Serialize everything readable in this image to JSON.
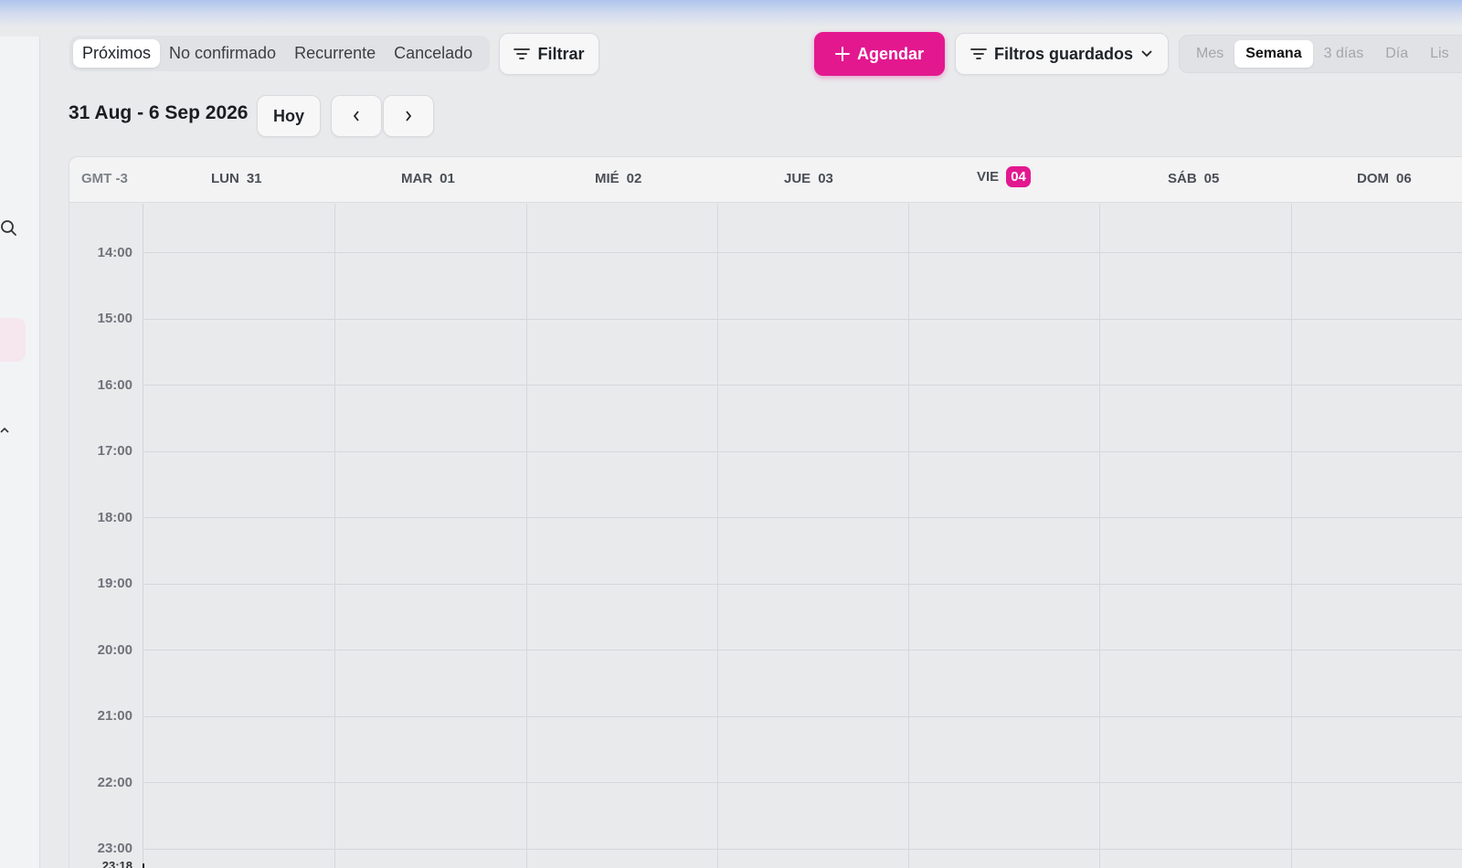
{
  "status_tabs": [
    {
      "label": "Próximos",
      "active": true
    },
    {
      "label": "No confirmado",
      "active": false
    },
    {
      "label": "Recurrente",
      "active": false
    },
    {
      "label": "Cancelado",
      "active": false
    }
  ],
  "toolbar": {
    "filter_label": "Filtrar",
    "schedule_label": "Agendar",
    "saved_filters_label": "Filtros guardados"
  },
  "views": [
    {
      "label": "Mes",
      "active": false
    },
    {
      "label": "Semana",
      "active": true
    },
    {
      "label": "3 días",
      "active": false
    },
    {
      "label": "Día",
      "active": false
    },
    {
      "label": "Lis",
      "active": false
    }
  ],
  "nav": {
    "range": "31 Aug - 6 Sep 2026",
    "today_label": "Hoy"
  },
  "calendar": {
    "timezone": "GMT -3",
    "days": [
      {
        "name": "LUN",
        "num": "31",
        "today": false
      },
      {
        "name": "MAR",
        "num": "01",
        "today": false
      },
      {
        "name": "MIÉ",
        "num": "02",
        "today": false
      },
      {
        "name": "JUE",
        "num": "03",
        "today": false
      },
      {
        "name": "VIE",
        "num": "04",
        "today": true
      },
      {
        "name": "SÁB",
        "num": "05",
        "today": false
      },
      {
        "name": "DOM",
        "num": "06",
        "today": false
      }
    ],
    "hours": [
      "14:00",
      "15:00",
      "16:00",
      "17:00",
      "18:00",
      "19:00",
      "20:00",
      "21:00",
      "22:00",
      "23:00"
    ],
    "current_time": "23:18"
  },
  "colors": {
    "accent": "#e3188f"
  },
  "icons": {
    "filter": "filter-icon",
    "plus": "plus-icon",
    "chevron_down": "chevron-down-icon",
    "chevron_left": "chevron-left-icon",
    "chevron_right": "chevron-right-icon",
    "search": "search-icon"
  }
}
